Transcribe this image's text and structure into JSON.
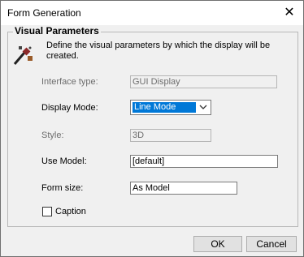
{
  "window": {
    "title": "Form Generation",
    "close_glyph": "✕"
  },
  "group": {
    "title": "Visual Parameters",
    "description": "Define the visual parameters by which the display will be created."
  },
  "fields": {
    "interface_type": {
      "label": "Interface type:",
      "value": "GUI Display"
    },
    "display_mode": {
      "label": "Display Mode:",
      "value": "Line Mode"
    },
    "style": {
      "label": "Style:",
      "value": "3D"
    },
    "use_model": {
      "label": "Use Model:",
      "value": "[default]"
    },
    "form_size": {
      "label": "Form size:",
      "value": "As Model"
    }
  },
  "caption": {
    "label": "Caption",
    "checked": false
  },
  "buttons": {
    "ok": "OK",
    "cancel": "Cancel"
  },
  "icons": {
    "group": "magic-wand-icon",
    "dropdown": "chevron-down-icon"
  },
  "colors": {
    "selection": "#0078d7"
  }
}
